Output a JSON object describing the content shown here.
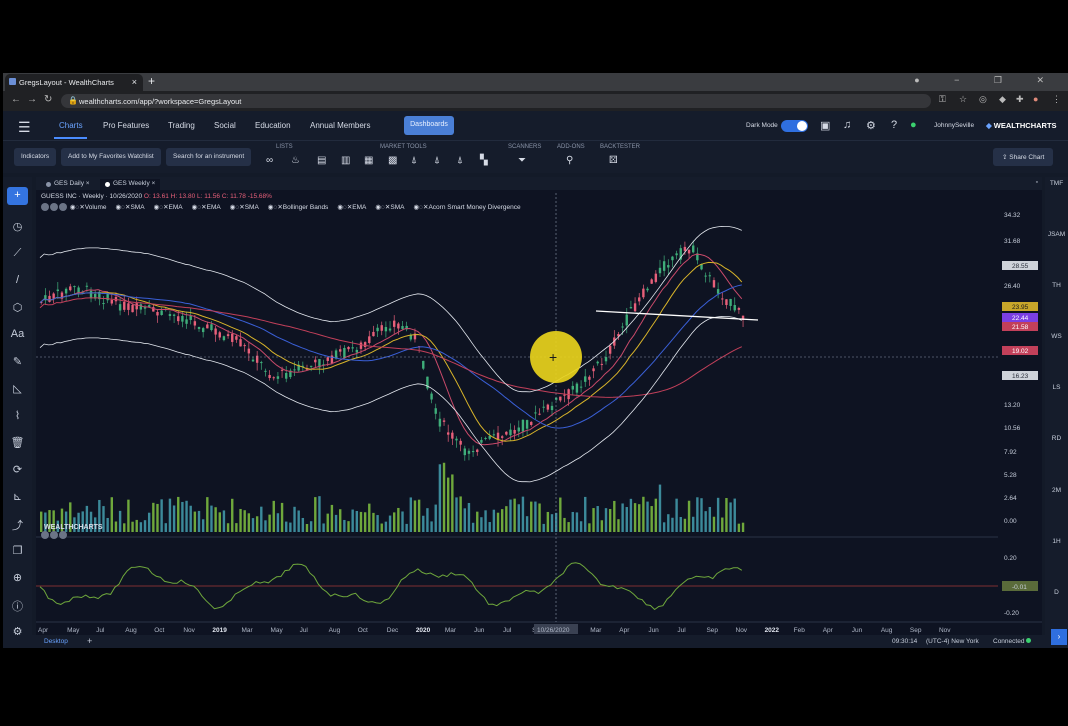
{
  "browser": {
    "tab_title": "GregsLayout - WealthCharts",
    "url": "wealthcharts.com/app/?workspace=GregsLayout"
  },
  "nav": {
    "links": [
      "Charts",
      "Pro Features",
      "Trading",
      "Social",
      "Education",
      "Annual Members"
    ],
    "dashboards_label": "Dashboards",
    "dark_mode_label": "Dark Mode",
    "username": "JohnnySeville",
    "logo_text": "WEALTHCHARTS"
  },
  "toolbar": {
    "indicators_label": "Indicators",
    "favorites_label": "Add to My Favorites Watchlist",
    "search_label": "Search for an instrument",
    "groups": [
      "LISTS",
      "MARKET TOOLS",
      "SCANNERS",
      "ADD-ONS",
      "BACKTESTER"
    ],
    "share_label": "Share Chart"
  },
  "chart_tabs": [
    "GES Daily",
    "GES Weekly"
  ],
  "symbol": {
    "name": "GUESS INC",
    "interval": "Weekly",
    "date": "10/26/2020",
    "ohlc": "O: 13.61 H: 13.80 L: 11.56 C: 11.78 -15.68%"
  },
  "indicators": [
    "Volume",
    "SMA",
    "EMA",
    "EMA",
    "SMA",
    "Bollinger Bands",
    "EMA",
    "SMA",
    "Acorn Smart Money Divergence"
  ],
  "price_axis": [
    "34.32",
    "31.68",
    "26.40",
    "13.20",
    "10.56",
    "7.92",
    "5.28",
    "2.64",
    "0.00"
  ],
  "price_tags": [
    {
      "text": "28.55",
      "bg": "#cfd3da",
      "fg": "#2a2f3a"
    },
    {
      "text": "23.95",
      "bg": "#c8a62a",
      "fg": "#1a1a1a"
    },
    {
      "text": "22.44",
      "bg": "#7b3fe4",
      "fg": "#ffffff"
    },
    {
      "text": "21.58",
      "bg": "#c2405a",
      "fg": "#ffffff"
    },
    {
      "text": "19.02",
      "bg": "#c2405a",
      "fg": "#ffffff"
    },
    {
      "text": "16.23",
      "bg": "#cfd3da",
      "fg": "#2a2f3a"
    }
  ],
  "osc_axis": [
    "0.20",
    "-0.20"
  ],
  "osc_tag": "-0.01",
  "time_axis": [
    {
      "t": "Apr",
      "y": false
    },
    {
      "t": "May",
      "y": false
    },
    {
      "t": "Jul",
      "y": false
    },
    {
      "t": "Aug",
      "y": false
    },
    {
      "t": "Oct",
      "y": false
    },
    {
      "t": "Nov",
      "y": false
    },
    {
      "t": "2019",
      "y": true
    },
    {
      "t": "Mar",
      "y": false
    },
    {
      "t": "May",
      "y": false
    },
    {
      "t": "Jul",
      "y": false
    },
    {
      "t": "Aug",
      "y": false
    },
    {
      "t": "Oct",
      "y": false
    },
    {
      "t": "Dec",
      "y": false
    },
    {
      "t": "2020",
      "y": true
    },
    {
      "t": "Mar",
      "y": false
    },
    {
      "t": "Jun",
      "y": false
    },
    {
      "t": "Jul",
      "y": false
    },
    {
      "t": "Sep",
      "y": false
    },
    {
      "t": "2021",
      "y": true
    },
    {
      "t": "Mar",
      "y": false
    },
    {
      "t": "Apr",
      "y": false
    },
    {
      "t": "Jun",
      "y": false
    },
    {
      "t": "Jul",
      "y": false
    },
    {
      "t": "Sep",
      "y": false
    },
    {
      "t": "Nov",
      "y": false
    },
    {
      "t": "2022",
      "y": true
    },
    {
      "t": "Feb",
      "y": false
    },
    {
      "t": "Apr",
      "y": false
    },
    {
      "t": "Jun",
      "y": false
    },
    {
      "t": "Aug",
      "y": false
    },
    {
      "t": "Sep",
      "y": false
    },
    {
      "t": "Nov",
      "y": false
    }
  ],
  "crosshair_date": "10/26/2020",
  "watermark": "WEALTHCHARTS",
  "right_strip": [
    "TMF",
    "JSAM",
    "TH",
    "WS",
    "LS",
    "RD",
    "2M",
    "1H",
    "D"
  ],
  "status": {
    "layout": "Desktop",
    "time": "09:30:14",
    "timezone": "(UTC-4) New York",
    "connection": "Connected"
  },
  "colors": {
    "accent": "#3474e0",
    "candle_up": "#3fae7a",
    "candle_down": "#e8607a",
    "volume": "#6fa83c",
    "ema_yellow": "#d8b42a",
    "sma_blue": "#3a5fd6",
    "sma_red": "#c2405a"
  }
}
